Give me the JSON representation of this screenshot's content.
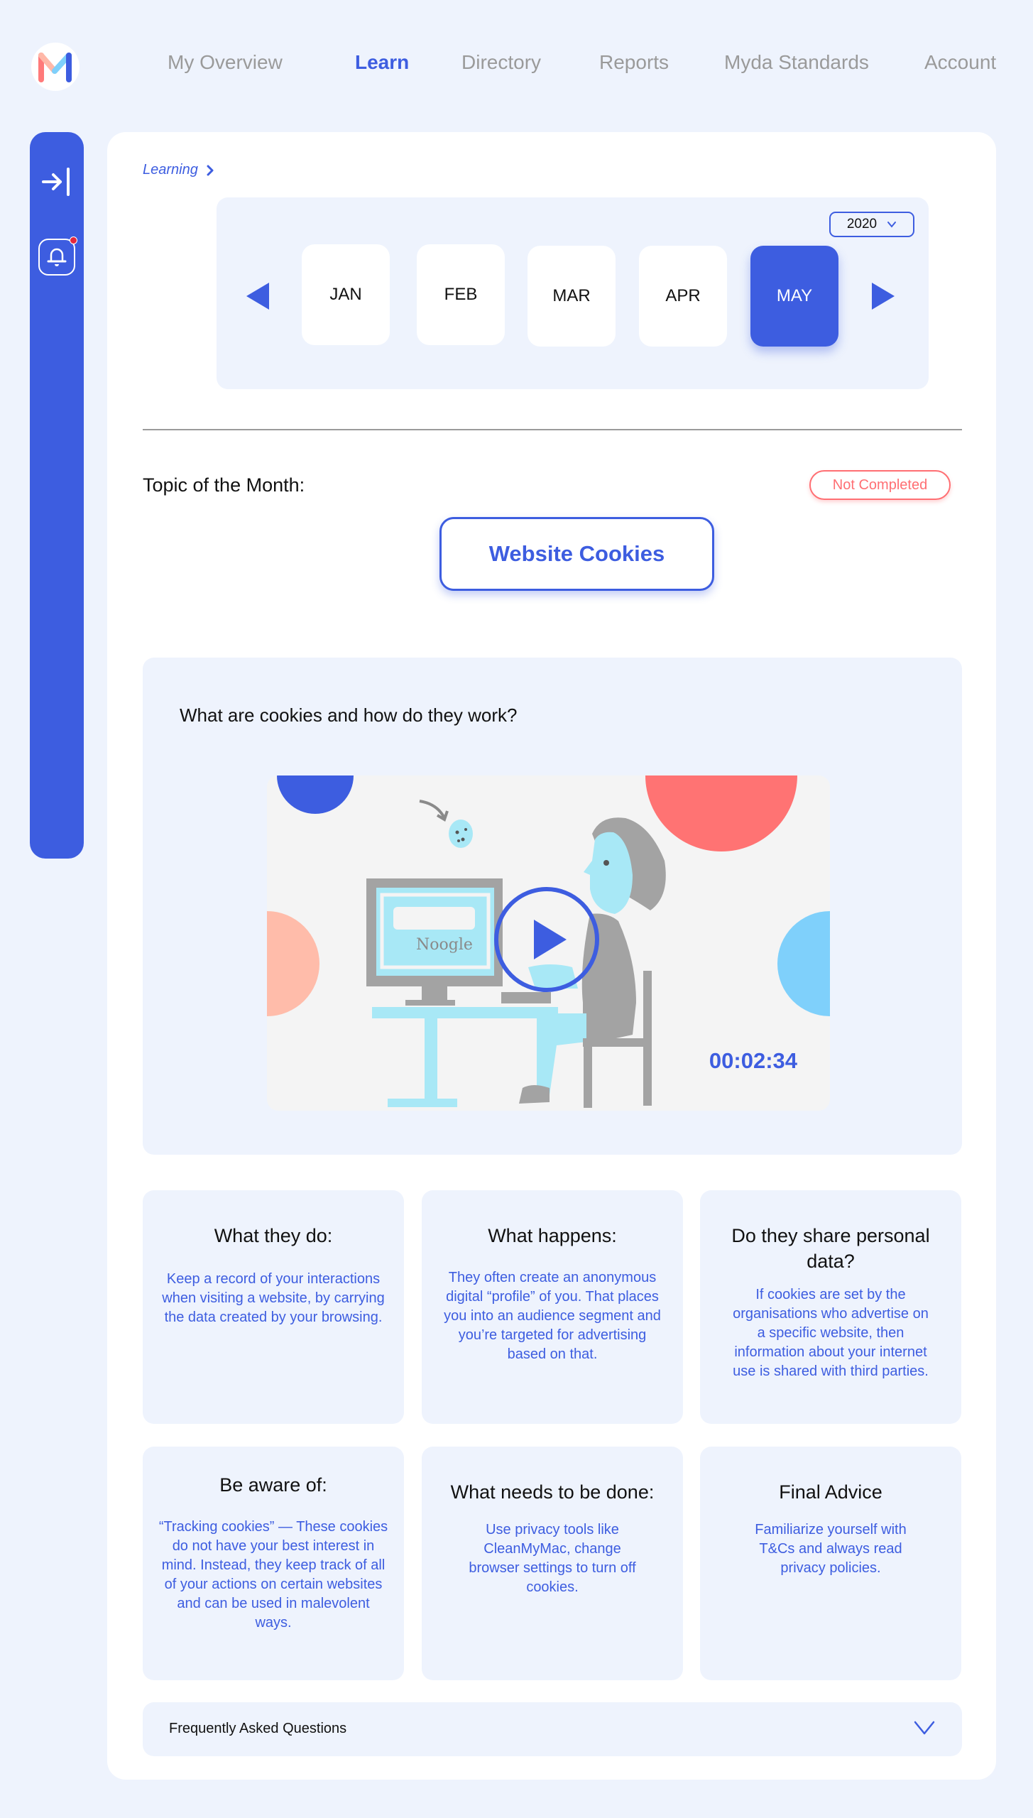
{
  "nav": {
    "logo_letter": "M",
    "items": [
      {
        "label": "My Overview",
        "active": false
      },
      {
        "label": "Learn",
        "active": true
      },
      {
        "label": "Directory",
        "active": false
      },
      {
        "label": "Reports",
        "active": false
      },
      {
        "label": "Myda Standards",
        "active": false
      },
      {
        "label": "Account",
        "active": false
      }
    ]
  },
  "sidebar": {
    "items": [
      {
        "icon": "collapse-arrow-icon"
      },
      {
        "icon": "bell-icon",
        "has_notification": true
      }
    ]
  },
  "breadcrumb": {
    "label": "Learning"
  },
  "month_picker": {
    "year": "2020",
    "months": [
      "JAN",
      "FEB",
      "MAR",
      "APR",
      "MAY"
    ],
    "selected": "MAY"
  },
  "topic": {
    "label": "Topic of the Month:",
    "title": "Website Cookies",
    "status": "Not Completed"
  },
  "video": {
    "title": "What are cookies and how do they work?",
    "duration": "00:02:34",
    "illustration_text": "Noogle"
  },
  "cards": [
    {
      "title": "What they do:",
      "body": "Keep a record of your interactions when visiting a website, by  carrying the data created by your browsing."
    },
    {
      "title": "What happens:",
      "body": "They often create an anonymous digital “profile” of you. That places you into an audience segment and you’re targeted for advertising based on that."
    },
    {
      "title": "Do they share personal data?",
      "body": "If cookies are set by the organisations who advertise on a specific website, then information about your internet use is shared with third parties."
    },
    {
      "title": "Be aware of:",
      "body": "“Tracking cookies” — These cookies do not have your best interest in mind. Instead, they keep track of all of your actions on certain websites and can be used in malevolent ways."
    },
    {
      "title": "What needs to be done:",
      "body": "Use privacy tools like CleanMyMac, change browser settings to turn off cookies."
    },
    {
      "title": "Final Advice",
      "body": "Familiarize yourself with T&Cs and always read privacy policies."
    }
  ],
  "faq": {
    "label": "Frequently Asked Questions"
  },
  "colors": {
    "accent": "#3d5de0",
    "background": "#eef3fd",
    "status_incomplete": "#ff6f73",
    "nav_inactive": "#9a9a9a"
  }
}
